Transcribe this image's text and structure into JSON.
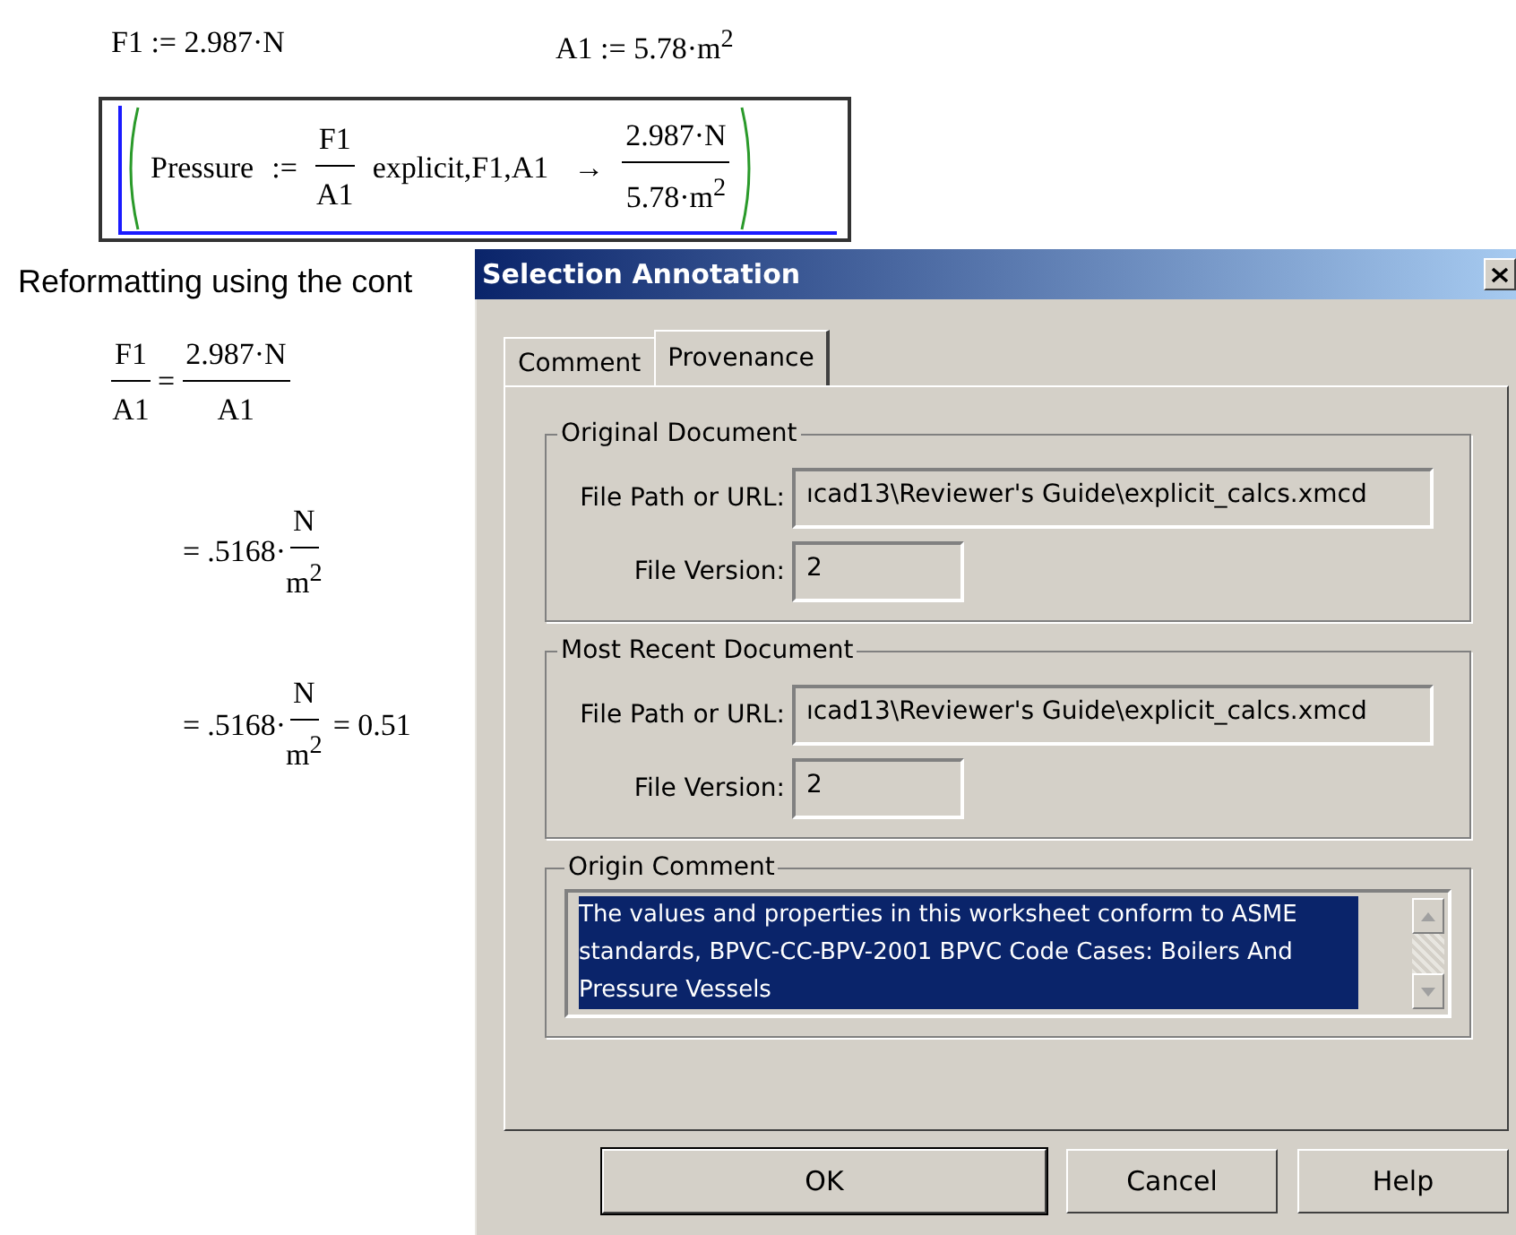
{
  "worksheet": {
    "definitions": [
      {
        "name": "F1",
        "op": ":=",
        "value": "2.987·N"
      },
      {
        "name": "A1",
        "op": ":=",
        "value": "5.78·m$^{2}$"
      }
    ],
    "pressure": {
      "name": "Pressure",
      "op": ":=",
      "numerator": "F1",
      "denominator": "A1",
      "keyword": "explicit,F1,A1",
      "arrow": "→",
      "result_numerator": "2.987·N",
      "result_denominator": "5.78·m$^{2}$",
      "selected": true
    },
    "note": "Reformatting using the cont",
    "equations": [
      {
        "lhs_numerator": "F1",
        "lhs_denominator": "A1",
        "eq": "=",
        "rhs_numerator": "2.987·N",
        "rhs_denominator": "A1"
      },
      {
        "eq": "=",
        "coefficient": ".5168·",
        "rhs_numerator": "N",
        "rhs_denominator": "m$^{2}$"
      },
      {
        "eq": "=",
        "coefficient": ".5168·",
        "rhs_numerator": "N",
        "rhs_denominator": "m$^{2}$",
        "tail": "= 0.51"
      }
    ]
  },
  "dialog": {
    "title": "Selection Annotation",
    "tabs": [
      {
        "label": "Comment",
        "selected": false
      },
      {
        "label": "Provenance",
        "selected": true
      }
    ],
    "groups": [
      {
        "title": "Original Document",
        "path_label": "File Path or URL:",
        "path_value": "ıcad13\\Reviewer's Guide\\explicit_calcs.xmcd",
        "version_label": "File Version:",
        "version_value": "2"
      },
      {
        "title": "Most Recent Document",
        "path_label": "File Path or URL:",
        "path_value": "ıcad13\\Reviewer's Guide\\explicit_calcs.xmcd",
        "version_label": "File Version:",
        "version_value": "2"
      }
    ],
    "origin_comment": {
      "title": "Origin Comment",
      "text": "The values and properties in this worksheet conform to ASME standards, BPVC-CC-BPV-2001 BPVC Code Cases: Boilers And Pressure Vessels",
      "selected": true
    },
    "buttons": [
      {
        "label": "OK",
        "default": true
      },
      {
        "label": "Cancel",
        "default": false
      },
      {
        "label": "Help",
        "default": false
      }
    ]
  }
}
